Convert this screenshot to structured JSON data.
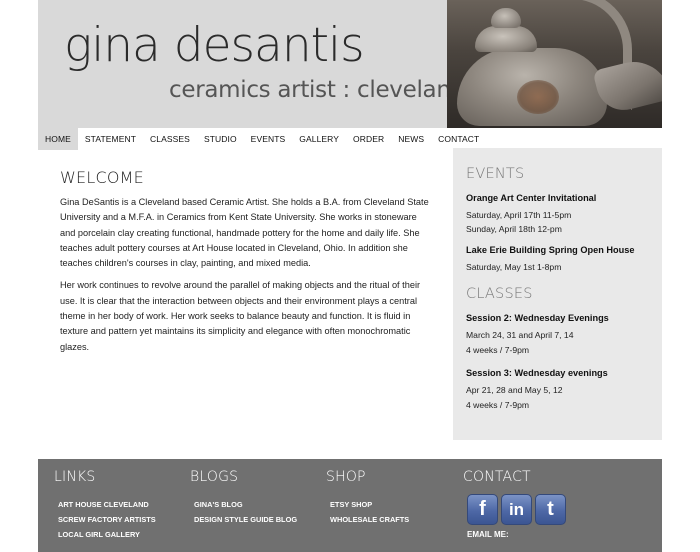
{
  "header": {
    "title": "gina desantis",
    "subtitle": "ceramics artist : cleveland"
  },
  "nav": {
    "items": [
      {
        "label": "HOME"
      },
      {
        "label": "STATEMENT"
      },
      {
        "label": "CLASSES"
      },
      {
        "label": "STUDIO"
      },
      {
        "label": "EVENTS"
      },
      {
        "label": "GALLERY"
      },
      {
        "label": "ORDER"
      },
      {
        "label": "NEWS"
      },
      {
        "label": "CONTACT"
      }
    ],
    "active": "HOME"
  },
  "main": {
    "heading": "WELCOME",
    "paragraphs": [
      "Gina DeSantis is a Cleveland based Ceramic Artist. She holds a B.A. from Cleveland State University and a M.F.A. in Ceramics from Kent State University. She works in stoneware and porcelain clay creating functional, handmade pottery for the home and daily life. She teaches adult pottery courses at Art House located in Cleveland, Ohio. In addition she teaches children's courses in clay, painting, and mixed media.",
      "Her work continues to revolve around the parallel of making objects and the ritual of their use. It is clear that the interaction between objects and their environment plays a central theme in her body of work. Her work seeks to balance beauty and function. It is fluid in texture and pattern yet maintains its simplicity and elegance with often monochromatic glazes."
    ]
  },
  "sidebar": {
    "events_heading": "EVENTS",
    "events": [
      {
        "title": "Orange Art Center Invitational",
        "lines": [
          "Saturday, April 17th 11-5pm",
          "Sunday, April 18th 12-pm"
        ]
      },
      {
        "title": "Lake Erie Building Spring Open House",
        "lines": [
          "Saturday, May 1st 1-8pm"
        ]
      }
    ],
    "classes_heading": "CLASSES",
    "classes": [
      {
        "title": "Session 2: Wednesday Evenings",
        "lines": [
          "March 24, 31 and April 7, 14",
          "4 weeks / 7-9pm"
        ]
      },
      {
        "title": "Session 3: Wednesday evenings",
        "lines": [
          "Apr 21, 28 and May 5, 12",
          "4 weeks / 7-9pm"
        ]
      }
    ]
  },
  "footer": {
    "links": {
      "heading": "LINKS",
      "items": [
        "ART HOUSE CLEVELAND",
        "SCREW FACTORY ARTISTS",
        "LOCAL GIRL GALLERY"
      ]
    },
    "blogs": {
      "heading": "BLOGS",
      "items": [
        "GINA'S BLOG",
        "DESIGN STYLE GUIDE BLOG"
      ]
    },
    "shop": {
      "heading": "SHOP",
      "items": [
        "ETSY SHOP",
        "WHOLESALE CRAFTS"
      ]
    },
    "contact": {
      "heading": "CONTACT",
      "social": [
        {
          "name": "facebook-icon",
          "glyph": "f"
        },
        {
          "name": "linkedin-icon",
          "glyph": "in"
        },
        {
          "name": "tumblr-icon",
          "glyph": "t"
        }
      ],
      "email_label": "EMAIL ME:"
    }
  },
  "colors": {
    "header_bg": "#d9d9d9",
    "sidebar_bg": "#e9e9e9",
    "footer_bg": "#707070",
    "social_blue": "#4e68a6"
  }
}
